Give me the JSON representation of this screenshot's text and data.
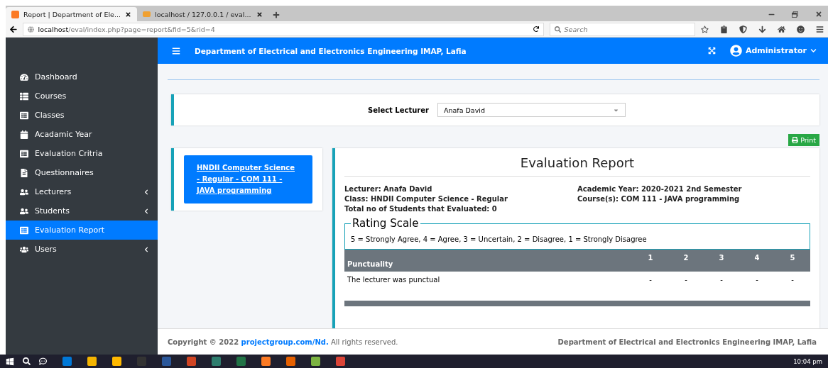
{
  "browser": {
    "tabs": [
      {
        "title": "Report | Department of Ele...",
        "kind": "xampp",
        "selected": true
      },
      {
        "title": "localhost / 127.0.0.1 / eval...",
        "kind": "pma",
        "selected": false
      }
    ],
    "url_host": "localhost",
    "url_path": "/eval/index.php?page=report&fid=5&rid=4",
    "search_placeholder": "Search"
  },
  "header": {
    "title": "Department of Electrical and Electronics Engineering IMAP, Lafia",
    "user": "Administrator"
  },
  "sidebar": {
    "items": [
      {
        "label": "Dashboard",
        "kind": "dashboard",
        "submenu": false,
        "selected": false
      },
      {
        "label": "Courses",
        "kind": "list",
        "submenu": false,
        "selected": false
      },
      {
        "label": "Classes",
        "kind": "card",
        "submenu": false,
        "selected": false
      },
      {
        "label": "Acadamic Year",
        "kind": "calendar",
        "submenu": false,
        "selected": false
      },
      {
        "label": "Evaluation Critria",
        "kind": "card",
        "submenu": false,
        "selected": false
      },
      {
        "label": "Questionnaires",
        "kind": "file",
        "submenu": false,
        "selected": false
      },
      {
        "label": "Lecturers",
        "kind": "people",
        "submenu": true,
        "selected": false
      },
      {
        "label": "Students",
        "kind": "people",
        "submenu": true,
        "selected": false
      },
      {
        "label": "Evaluation Report",
        "kind": "card",
        "submenu": false,
        "selected": true
      },
      {
        "label": "Users",
        "kind": "group",
        "submenu": true,
        "selected": false
      }
    ]
  },
  "lecturer_select": {
    "label": "Select Lecturer",
    "value": "Anafa David"
  },
  "print_button": "Print",
  "class_links": [
    {
      "text": "HNDII Computer Science - Regular - COM 111 - JAVA programming",
      "selected": true
    }
  ],
  "report": {
    "title": "Evaluation Report",
    "fields_left": [
      "Lecturer: Anafa David",
      "Class: HNDII Computer Science - Regular",
      "Total no of Students that Evaluated: 0"
    ],
    "fields_right": [
      "Academic Year: 2020-2021 2nd Semester",
      "Course(s): COM 111 - JAVA programming"
    ],
    "rating_scale": {
      "legend": "Rating Scale",
      "text": "5 = Strongly Agree, 4 = Agree, 3 = Uncertain, 2 = Disagree, 1 = Strongly Disagree"
    },
    "table": {
      "section": "Punctuality",
      "columns": [
        "1",
        "2",
        "3",
        "4",
        "5"
      ],
      "rows": [
        {
          "question": "The lecturer was punctual",
          "values": [
            "-",
            "-",
            "-",
            "-",
            "-"
          ]
        }
      ]
    }
  },
  "footer": {
    "copyright_before": "Copyright © 2022 ",
    "copyright_link": "projectgroup.com/Nd.",
    "copyright_after": " All rights reserved.",
    "right": "Department of Electrical and Electronics Engineering IMAP, Lafia"
  },
  "taskbar": {
    "time": "10:04 pm"
  }
}
